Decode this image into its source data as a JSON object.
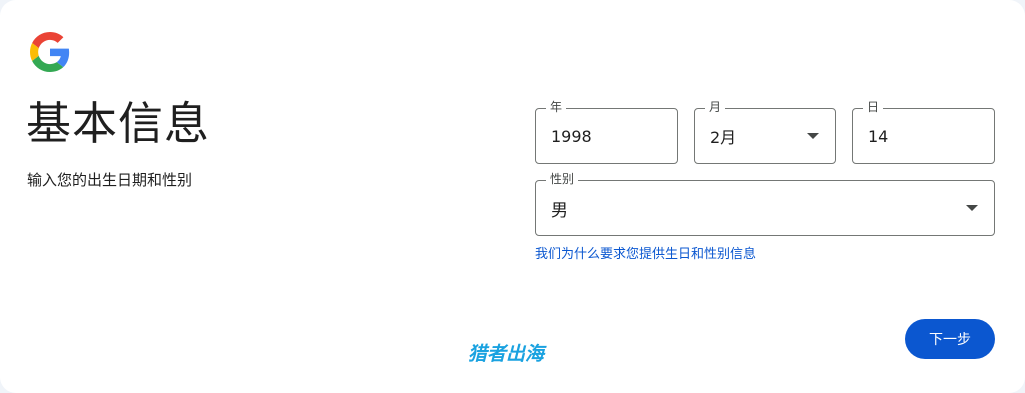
{
  "header": {
    "title": "基本信息",
    "subtitle": "输入您的出生日期和性别"
  },
  "birthday": {
    "year": {
      "label": "年",
      "value": "1998"
    },
    "month": {
      "label": "月",
      "value": "2月"
    },
    "day": {
      "label": "日",
      "value": "14"
    }
  },
  "gender": {
    "label": "性别",
    "value": "男"
  },
  "help_link": "我们为什么要求您提供生日和性别信息",
  "watermark": "猎者出海",
  "next_button": "下一步",
  "colors": {
    "accent": "#0b57d0",
    "watermark": "#1aa2e0",
    "google_blue": "#4285F4",
    "google_red": "#EA4335",
    "google_yellow": "#FBBC05",
    "google_green": "#34A853"
  }
}
